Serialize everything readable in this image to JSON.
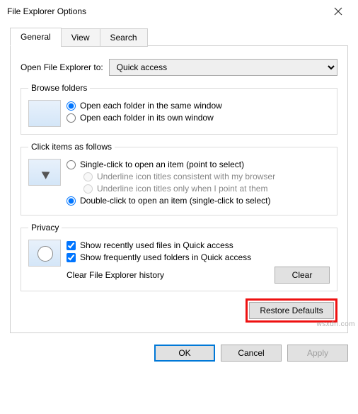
{
  "window": {
    "title": "File Explorer Options"
  },
  "tabs": [
    "General",
    "View",
    "Search"
  ],
  "openExplorer": {
    "label": "Open File Explorer to:",
    "value": "Quick access"
  },
  "browse": {
    "legend": "Browse folders",
    "same_window": "Open each folder in the same window",
    "own_window": "Open each folder in its own window"
  },
  "click": {
    "legend": "Click items as follows",
    "single": "Single-click to open an item (point to select)",
    "underline_browser": "Underline icon titles consistent with my browser",
    "underline_point": "Underline icon titles only when I point at them",
    "double": "Double-click to open an item (single-click to select)"
  },
  "privacy": {
    "legend": "Privacy",
    "recent_files": "Show recently used files in Quick access",
    "frequent_folders": "Show frequently used folders in Quick access",
    "clear_label": "Clear File Explorer history",
    "clear_btn": "Clear"
  },
  "restore_btn": "Restore Defaults",
  "footer": {
    "ok": "OK",
    "cancel": "Cancel",
    "apply": "Apply"
  },
  "watermark": "wsxdn.com"
}
